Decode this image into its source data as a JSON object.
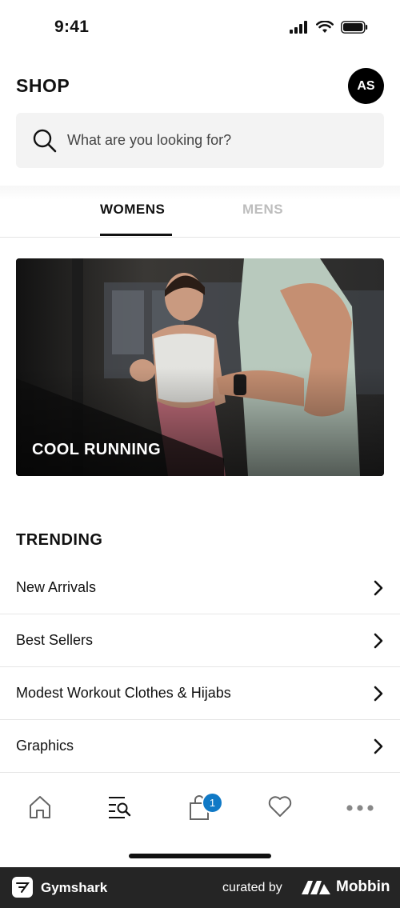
{
  "status_bar": {
    "time": "9:41"
  },
  "header": {
    "title": "SHOP",
    "avatar_initials": "AS"
  },
  "search": {
    "placeholder": "What are you looking for?"
  },
  "gender_tabs": [
    {
      "label": "WOMENS",
      "selected": true
    },
    {
      "label": "MENS",
      "selected": false
    }
  ],
  "banner": {
    "title": "COOL RUNNING"
  },
  "trending": {
    "title": "TRENDING",
    "items": [
      {
        "label": "New Arrivals"
      },
      {
        "label": "Best Sellers"
      },
      {
        "label": "Modest Workout Clothes & Hijabs"
      },
      {
        "label": "Graphics"
      }
    ]
  },
  "tab_bar": {
    "items": [
      {
        "icon": "home-icon"
      },
      {
        "icon": "shop-search-icon",
        "active": true
      },
      {
        "icon": "bag-icon",
        "badge": "1"
      },
      {
        "icon": "heart-icon"
      },
      {
        "icon": "more-icon"
      }
    ]
  },
  "footer": {
    "app_name": "Gymshark",
    "curated_by": "curated by",
    "brand": "Mobbin"
  },
  "colors": {
    "accent": "#1079c6",
    "text": "#111111",
    "inactive_tab": "#bdbdbd",
    "footer_bg": "#252525"
  }
}
